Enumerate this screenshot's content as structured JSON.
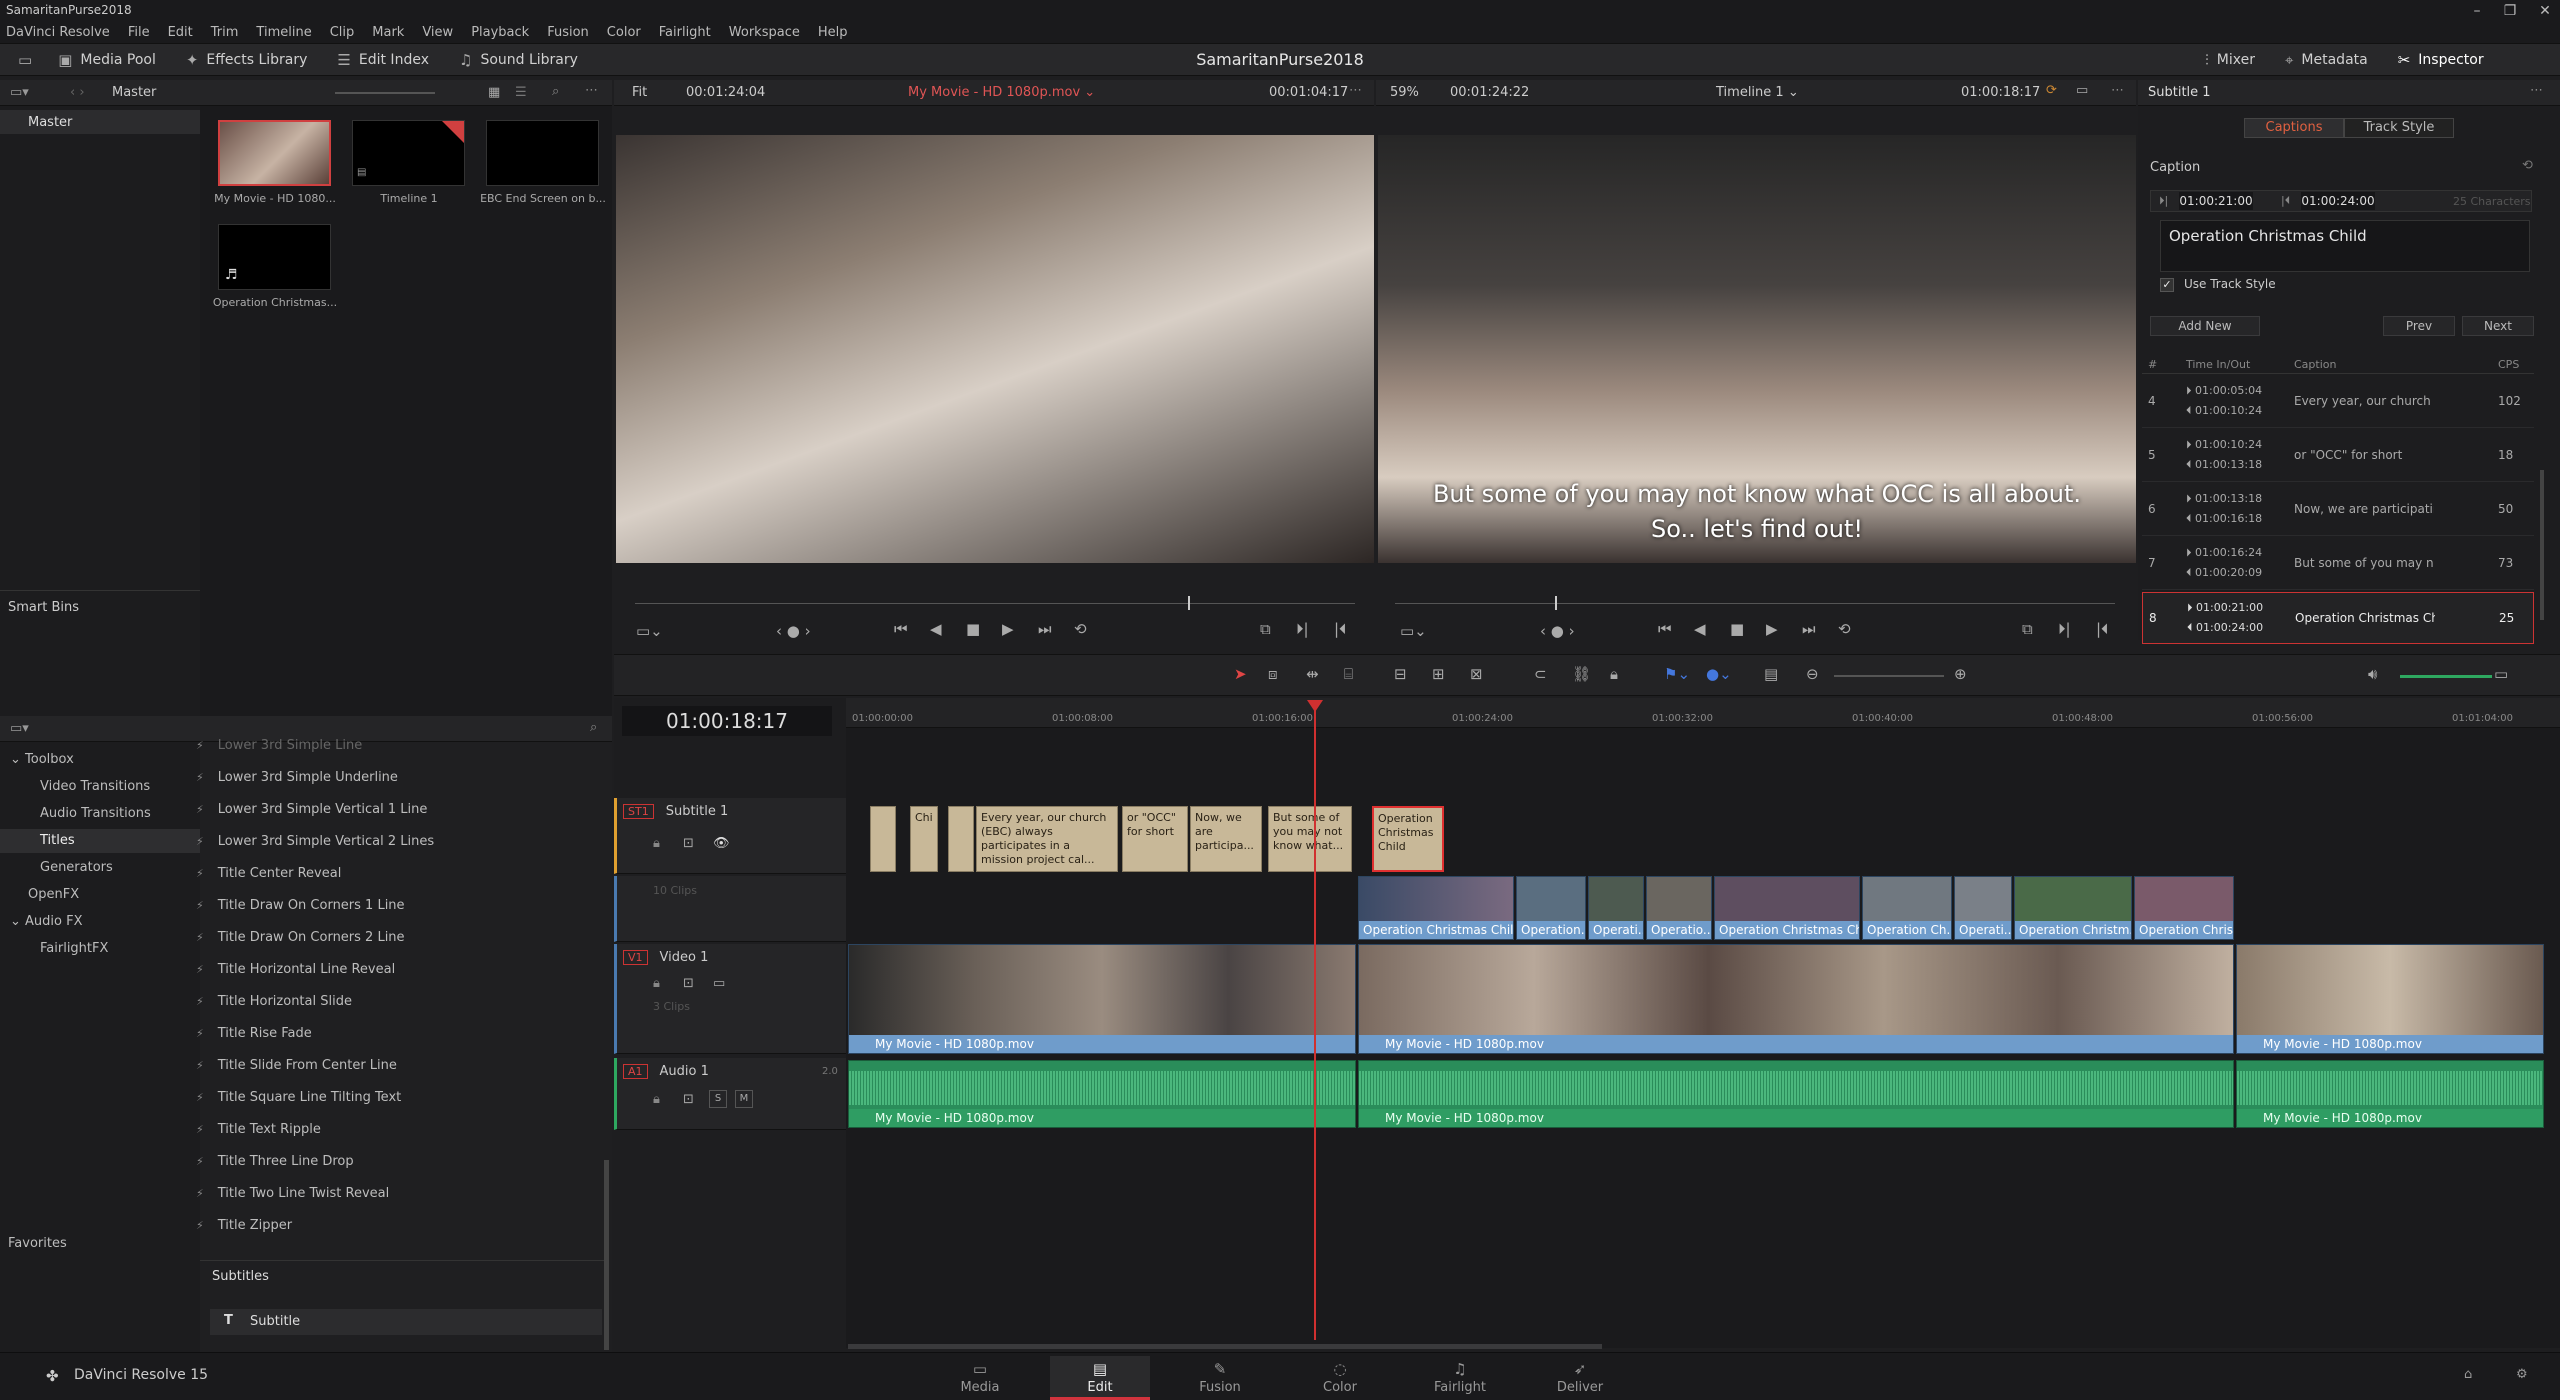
{
  "window": {
    "title": "SamaritanPurse2018"
  },
  "menu": [
    "DaVinci Resolve",
    "File",
    "Edit",
    "Trim",
    "Timeline",
    "Clip",
    "Mark",
    "View",
    "Playback",
    "Fusion",
    "Color",
    "Fairlight",
    "Workspace",
    "Help"
  ],
  "toolbar": {
    "media_pool": "Media Pool",
    "effects_library": "Effects Library",
    "edit_index": "Edit Index",
    "sound_library": "Sound Library",
    "project_title": "SamaritanPurse2018",
    "mixer": "Mixer",
    "metadata": "Metadata",
    "inspector": "Inspector"
  },
  "media_pool": {
    "bin": "Master",
    "tree_master": "Master",
    "smart_bins": "Smart Bins",
    "clips": [
      {
        "label": "My Movie - HD 1080..."
      },
      {
        "label": "Timeline 1"
      },
      {
        "label": "EBC End Screen on b..."
      },
      {
        "label": "Operation Christmas..."
      }
    ]
  },
  "effects": {
    "tree": {
      "toolbox": "Toolbox",
      "video_transitions": "Video Transitions",
      "audio_transitions": "Audio Transitions",
      "titles": "Titles",
      "generators": "Generators",
      "openfx": "OpenFX",
      "audio_fx": "Audio FX",
      "fairlight_fx": "FairlightFX",
      "favorites": "Favorites"
    },
    "cut_item": "Lower 3rd Simple Line",
    "items": [
      "Lower 3rd Simple Underline",
      "Lower 3rd Simple Vertical 1 Line",
      "Lower 3rd Simple Vertical 2 Lines",
      "Title Center Reveal",
      "Title Draw On Corners 1 Line",
      "Title Draw On Corners 2 Line",
      "Title Horizontal Line Reveal",
      "Title Horizontal Slide",
      "Title Rise Fade",
      "Title Slide From Center Line",
      "Title Square Line Tilting Text",
      "Title Text Ripple",
      "Title Three Line Drop",
      "Title Two Line Twist Reveal",
      "Title Zipper"
    ],
    "subtitles_header": "Subtitles",
    "subtitle_item": "Subtitle"
  },
  "source_viewer": {
    "fit": "Fit",
    "tc_left": "00:01:24:04",
    "clip_name": "My Movie - HD 1080p.mov",
    "tc_right": "00:01:04:17"
  },
  "timeline_viewer": {
    "zoom": "59%",
    "tc_left": "00:01:24:22",
    "timeline_name": "Timeline 1",
    "tc_right": "01:00:18:17",
    "subtitle_line1": "But some of you may not know what OCC is all about.",
    "subtitle_line2": "So.. let's find out!"
  },
  "inspector": {
    "title": "Subtitle 1",
    "tab_captions": "Captions",
    "tab_track_style": "Track Style",
    "caption_label": "Caption",
    "tc_in": "01:00:21:00",
    "tc_out": "01:00:24:00",
    "char_count": "25 Characters",
    "caption_text": "Operation Christmas Child",
    "use_track_style": "Use Track Style",
    "add_new": "Add New",
    "prev": "Prev",
    "next": "Next",
    "table_headers": [
      "#",
      "Time In/Out",
      "Caption",
      "CPS"
    ],
    "rows": [
      {
        "n": "4",
        "in": "01:00:05:04",
        "out": "01:00:10:24",
        "caption": "Every year, our church (EBC) ...",
        "cps": "102"
      },
      {
        "n": "5",
        "in": "01:00:10:24",
        "out": "01:00:13:18",
        "caption": "or \"OCC\" for short",
        "cps": "18"
      },
      {
        "n": "6",
        "in": "01:00:13:18",
        "out": "01:00:16:18",
        "caption": "Now, we are participating ag...",
        "cps": "50"
      },
      {
        "n": "7",
        "in": "01:00:16:24",
        "out": "01:00:20:09",
        "caption": "But some of you may not kn...",
        "cps": "73"
      },
      {
        "n": "8",
        "in": "01:00:21:00",
        "out": "01:00:24:00",
        "caption": "Operation Christmas Child",
        "cps": "25"
      }
    ]
  },
  "timeline": {
    "current_tc": "01:00:18:17",
    "ruler": [
      "01:00:00:00",
      "01:00:08:00",
      "01:00:16:00",
      "01:00:24:00",
      "01:00:32:00",
      "01:00:40:00",
      "01:00:48:00",
      "01:00:56:00",
      "01:01:04:00"
    ],
    "subtitle_track": {
      "id": "ST1",
      "name": "Subtitle 1"
    },
    "subtitle_clips": [
      "Chi",
      "Every year, our church (EBC) always participates in a mission project cal...",
      "or \"OCC\" for short",
      "Now, we are participa...",
      "But some of you may not know what...",
      "Operation Christmas Child"
    ],
    "v2_info": "10 Clips",
    "v2_clips": [
      "Operation Christmas Chil...",
      "Operation...",
      "Operati...",
      "Operatio...",
      "Operation Christmas Ch...",
      "Operation Ch...",
      "Operati...",
      "Operation Christm...",
      "Operation Chris..."
    ],
    "video_track": {
      "id": "V1",
      "name": "Video 1",
      "info": "3 Clips"
    },
    "video_clips": [
      "My Movie - HD 1080p.mov",
      "My Movie - HD 1080p.mov",
      "My Movie - HD 1080p.mov"
    ],
    "audio_track": {
      "id": "A1",
      "name": "Audio 1",
      "level": "2.0",
      "s": "S",
      "m": "M"
    },
    "audio_clips": [
      "My Movie - HD 1080p.mov",
      "My Movie - HD 1080p.mov",
      "My Movie - HD 1080p.mov"
    ]
  },
  "pages": {
    "app": "DaVinci Resolve 15",
    "media": "Media",
    "edit": "Edit",
    "fusion": "Fusion",
    "color": "Color",
    "fairlight": "Fairlight",
    "deliver": "Deliver"
  }
}
